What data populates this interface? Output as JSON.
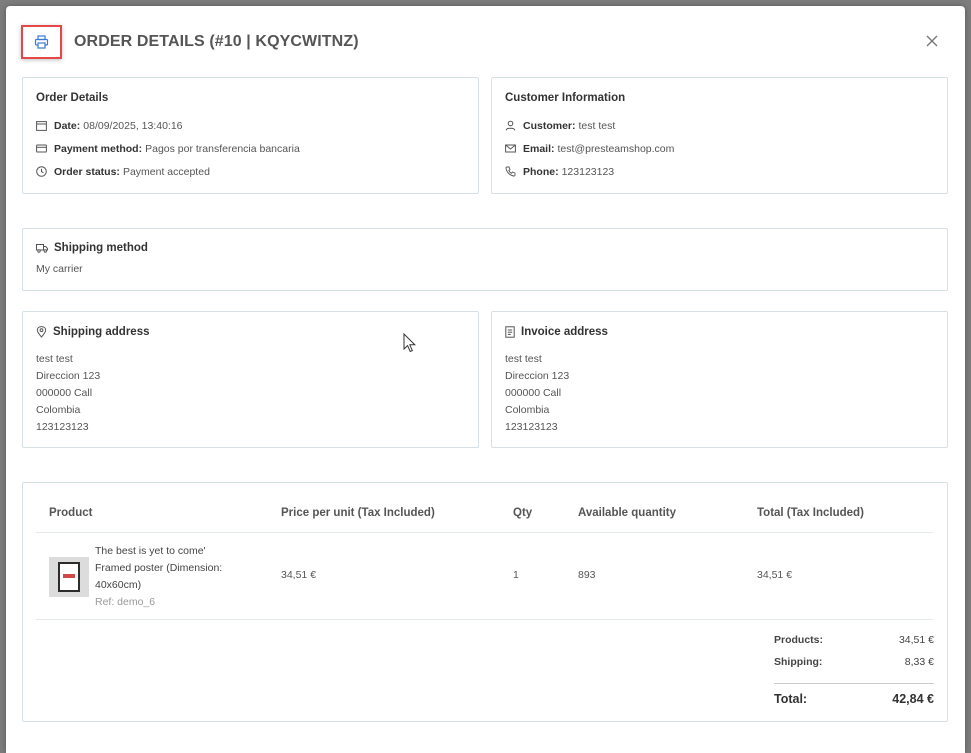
{
  "header": {
    "title": "ORDER DETAILS (#10 | KQYCWITNZ)"
  },
  "order_details": {
    "title": "Order Details",
    "date_label": "Date:",
    "date_value": "08/09/2025, 13:40:16",
    "payment_label": "Payment method:",
    "payment_value": "Pagos por transferencia bancaria",
    "status_label": "Order status:",
    "status_value": "Payment accepted"
  },
  "customer": {
    "title": "Customer Information",
    "customer_label": "Customer:",
    "customer_value": "test test",
    "email_label": "Email:",
    "email_value": "test@presteamshop.com",
    "phone_label": "Phone:",
    "phone_value": "123123123"
  },
  "shipping_method": {
    "title": "Shipping method",
    "value": "My carrier"
  },
  "shipping_address": {
    "title": "Shipping address",
    "lines": [
      "test test",
      "Direccion 123",
      "000000 Call",
      "Colombia",
      "123123123"
    ]
  },
  "invoice_address": {
    "title": "Invoice address",
    "lines": [
      "test test",
      "Direccion 123",
      "000000 Call",
      "Colombia",
      "123123123"
    ]
  },
  "products_table": {
    "headers": {
      "product": "Product",
      "price": "Price per unit (Tax Included)",
      "qty": "Qty",
      "available": "Available quantity",
      "total": "Total (Tax Included)"
    },
    "rows": [
      {
        "name_line1": "The best is yet to come'",
        "name_line2": "Framed poster (Dimension:",
        "name_line3": "40x60cm)",
        "ref": "Ref: demo_6",
        "price": "34,51 €",
        "qty": "1",
        "available": "893",
        "total": "34,51 €"
      }
    ]
  },
  "totals": {
    "products_label": "Products:",
    "products_value": "34,51 €",
    "shipping_label": "Shipping:",
    "shipping_value": "8,33 €",
    "total_label": "Total:",
    "total_value": "42,84 €"
  },
  "colors": {
    "accent": "#3b7bd6",
    "highlight_border": "#e54848",
    "card_border": "#d5e1e6"
  }
}
